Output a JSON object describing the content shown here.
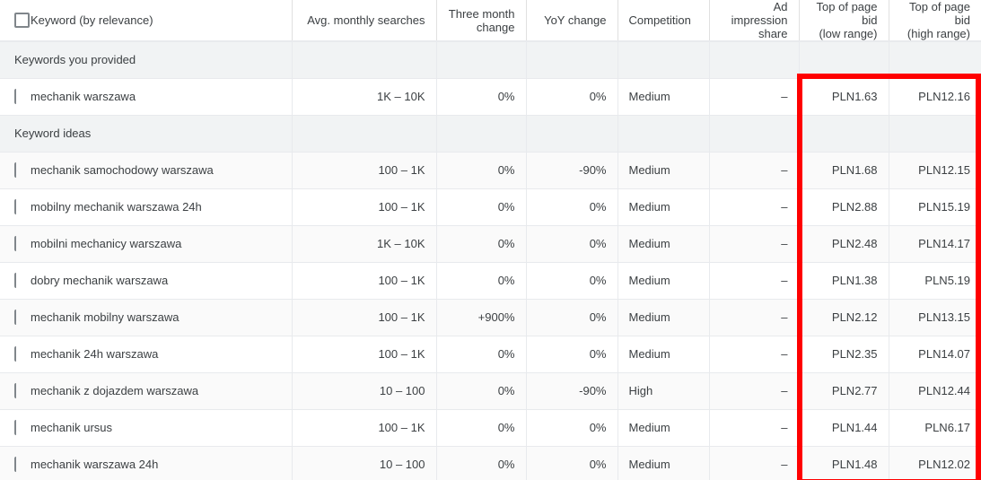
{
  "table": {
    "columns": [
      {
        "key": "select",
        "label": "",
        "align": "left"
      },
      {
        "key": "keyword",
        "label": "Keyword (by relevance)",
        "align": "left"
      },
      {
        "key": "avg",
        "label": "Avg. monthly searches",
        "align": "right"
      },
      {
        "key": "three_month",
        "label": "Three month change",
        "align": "right"
      },
      {
        "key": "yoy",
        "label": "YoY change",
        "align": "right"
      },
      {
        "key": "competition",
        "label": "Competition",
        "align": "left"
      },
      {
        "key": "ad_imp",
        "label": "Ad impression share",
        "align": "right"
      },
      {
        "key": "bid_low",
        "label": "Top of page bid (low range)",
        "align": "right"
      },
      {
        "key": "bid_high",
        "label": "Top of page bid (high range)",
        "align": "right"
      }
    ],
    "headers": {
      "keyword": "Keyword (by relevance)",
      "avg_monthly_searches": "Avg. monthly searches",
      "three_month_change_l1": "Three month",
      "three_month_change_l2": "change",
      "yoy_change": "YoY change",
      "competition": "Competition",
      "ad_impression_share_l1": "Ad impression",
      "ad_impression_share_l2": "share",
      "bid_low_l1": "Top of page bid",
      "bid_low_l2": "(low range)",
      "bid_high_l1": "Top of page bid",
      "bid_high_l2": "(high range)"
    },
    "groups": [
      {
        "label": "Keywords you provided",
        "rows": [
          {
            "keyword": "mechanik warszawa",
            "avg": "1K – 10K",
            "three_month": "0%",
            "yoy": "0%",
            "competition": "Medium",
            "ad_imp": "–",
            "bid_low": "PLN1.63",
            "bid_high": "PLN12.16"
          }
        ]
      },
      {
        "label": "Keyword ideas",
        "rows": [
          {
            "keyword": "mechanik samochodowy warszawa",
            "avg": "100 – 1K",
            "three_month": "0%",
            "yoy": "-90%",
            "competition": "Medium",
            "ad_imp": "–",
            "bid_low": "PLN1.68",
            "bid_high": "PLN12.15"
          },
          {
            "keyword": "mobilny mechanik warszawa 24h",
            "avg": "100 – 1K",
            "three_month": "0%",
            "yoy": "0%",
            "competition": "Medium",
            "ad_imp": "–",
            "bid_low": "PLN2.88",
            "bid_high": "PLN15.19"
          },
          {
            "keyword": "mobilni mechanicy warszawa",
            "avg": "1K – 10K",
            "three_month": "0%",
            "yoy": "0%",
            "competition": "Medium",
            "ad_imp": "–",
            "bid_low": "PLN2.48",
            "bid_high": "PLN14.17"
          },
          {
            "keyword": "dobry mechanik warszawa",
            "avg": "100 – 1K",
            "three_month": "0%",
            "yoy": "0%",
            "competition": "Medium",
            "ad_imp": "–",
            "bid_low": "PLN1.38",
            "bid_high": "PLN5.19"
          },
          {
            "keyword": "mechanik mobilny warszawa",
            "avg": "100 – 1K",
            "three_month": "+900%",
            "yoy": "0%",
            "competition": "Medium",
            "ad_imp": "–",
            "bid_low": "PLN2.12",
            "bid_high": "PLN13.15"
          },
          {
            "keyword": "mechanik 24h warszawa",
            "avg": "100 – 1K",
            "three_month": "0%",
            "yoy": "0%",
            "competition": "Medium",
            "ad_imp": "–",
            "bid_low": "PLN2.35",
            "bid_high": "PLN14.07"
          },
          {
            "keyword": "mechanik z dojazdem warszawa",
            "avg": "10 – 100",
            "three_month": "0%",
            "yoy": "-90%",
            "competition": "High",
            "ad_imp": "–",
            "bid_low": "PLN2.77",
            "bid_high": "PLN12.44"
          },
          {
            "keyword": "mechanik ursus",
            "avg": "100 – 1K",
            "three_month": "0%",
            "yoy": "0%",
            "competition": "Medium",
            "ad_imp": "–",
            "bid_low": "PLN1.44",
            "bid_high": "PLN6.17"
          },
          {
            "keyword": "mechanik warszawa 24h",
            "avg": "10 – 100",
            "three_month": "0%",
            "yoy": "0%",
            "competition": "Medium",
            "ad_imp": "–",
            "bid_low": "PLN1.48",
            "bid_high": "PLN12.02"
          }
        ]
      }
    ]
  },
  "annotation": {
    "type": "rectangle-highlight",
    "color": "#ff0000",
    "covers": "Top of page bid (low range) and Top of page bid (high range) columns"
  }
}
